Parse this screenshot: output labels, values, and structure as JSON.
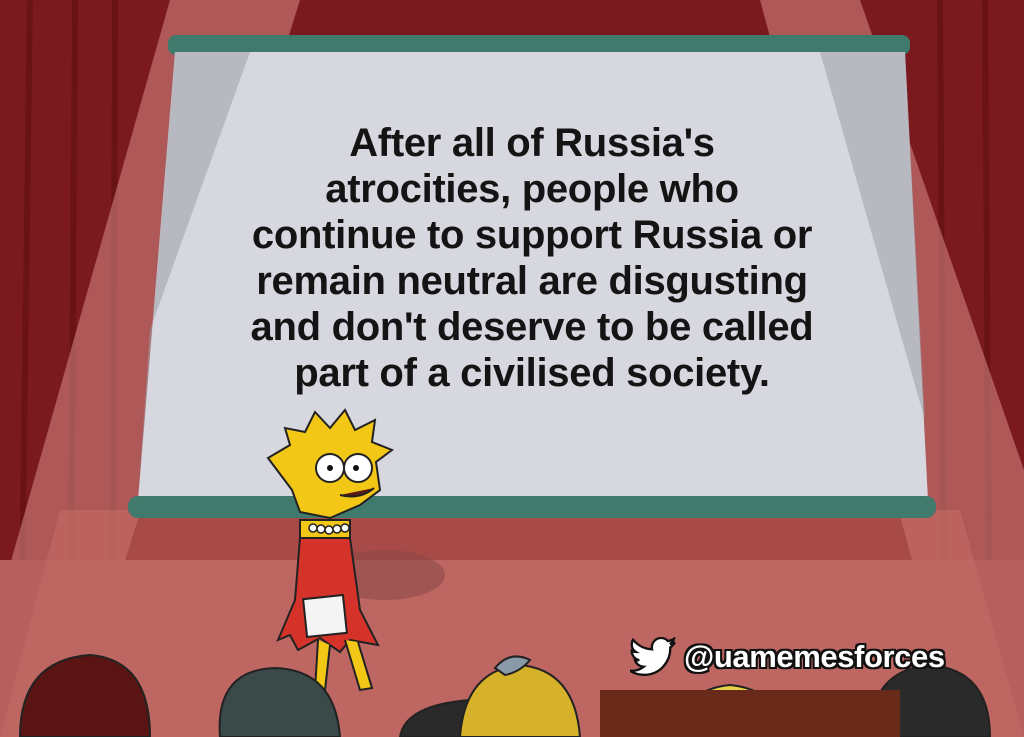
{
  "slide": {
    "lines": [
      "After all of Russia's",
      "atrocities, people who",
      "continue to support Russia or",
      "remain neutral are disgusting",
      "and don't deserve to be called",
      "part of a civilised society."
    ]
  },
  "watermark": {
    "icon": "twitter-bird-icon",
    "handle": "@uamemesforces"
  },
  "colors": {
    "curtain": "#7a1a1e",
    "stage_floor": "#b5605c",
    "screen": "#d7d7df",
    "screen_frame": "#3f7a6c",
    "character_skin": "#f2c716",
    "dress": "#d5322a"
  }
}
